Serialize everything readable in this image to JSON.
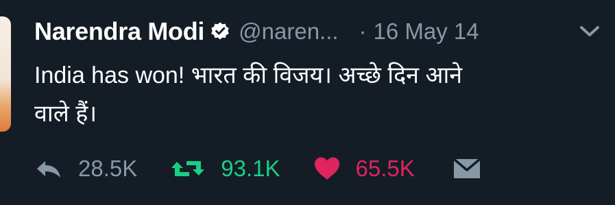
{
  "tweet": {
    "author_name": "Narendra Modi",
    "handle": "@naren...",
    "separator": "·",
    "date": "16 May 14",
    "text_line1": "India has won! भारत की विजय। अच्छे दिन आने",
    "text_line2": "वाले हैं।"
  },
  "actions": {
    "replies": "28.5K",
    "retweets": "93.1K",
    "likes": "65.5K"
  },
  "colors": {
    "background": "#141d26",
    "muted": "#8899a6",
    "retweet": "#19cf86",
    "like": "#e0245e"
  },
  "icons": [
    "verified-badge-icon",
    "chevron-down-icon",
    "reply-icon",
    "retweet-icon",
    "heart-icon",
    "direct-message-icon"
  ]
}
